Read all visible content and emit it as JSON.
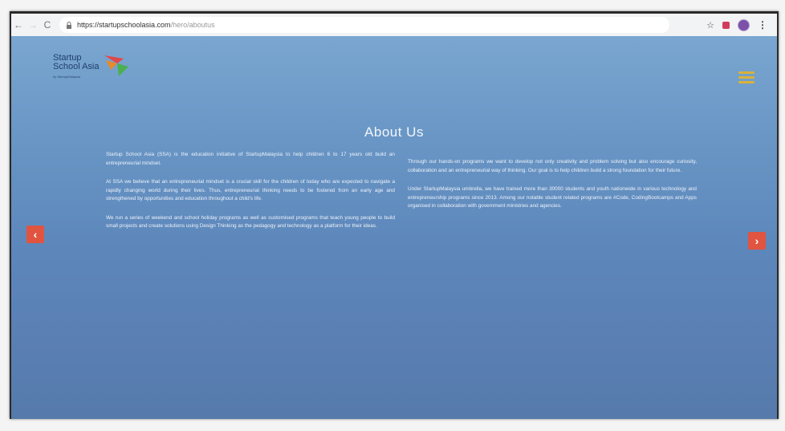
{
  "browser": {
    "back_icon": "back-arrow-icon",
    "forward_icon": "forward-arrow-icon",
    "reload_icon": "reload-icon",
    "url_domain": "https://startupschoolasia.com",
    "url_path": "/hero/aboutus",
    "back_glyph": "←",
    "forward_glyph": "→",
    "reload_glyph": "C",
    "lock_glyph": "🔒",
    "star_glyph": "☆",
    "menu_glyph": "⋮"
  },
  "site": {
    "logo_line1": "Startup",
    "logo_line2": "School Asia",
    "logo_tagline": "by StartupMalaysia",
    "title": "About Us",
    "left_paragraphs": [
      "Startup School Asia (SSA) is the education initiative of StartupMalaysia to help children 6 to 17 years old build an entrepreneurial mindset.",
      "At SSA we believe that an entrepreneurial mindset is a crucial skill for the children of today who are expected to navigate a rapidly changing world during their lives. Thus, entrepreneurial thinking needs to be fostered from an early age and strengthened by opportunities and education throughout a child's life.",
      "We run a series of weekend and school holiday programs as well as customised programs that teach young people to build small projects and create solutions using Design Thinking as the pedagogy and technology as a platform for their ideas."
    ],
    "right_paragraphs": [
      "Through our hands-on programs we want to develop not only creativity and problem solving but also encourage curiosity, collaboration and an entrepreneurial way of thinking. Our goal is to help children build a strong foundation for their future.",
      "Under StartupMalaysia umbrella, we have trained more than 30000 students and youth nationwide in various technology and entrepreneurship programs since 2013. Among our notable student related programs are #Code, CodingBootcamps and Apps organised in collaboration with government ministries and agencies."
    ],
    "prev_glyph": "‹",
    "next_glyph": "›"
  },
  "colors": {
    "accent": "#e05440",
    "hamburger": "#d8b23c",
    "page_bg_top": "#7aa6d0",
    "page_bg_bottom": "#557aab"
  }
}
